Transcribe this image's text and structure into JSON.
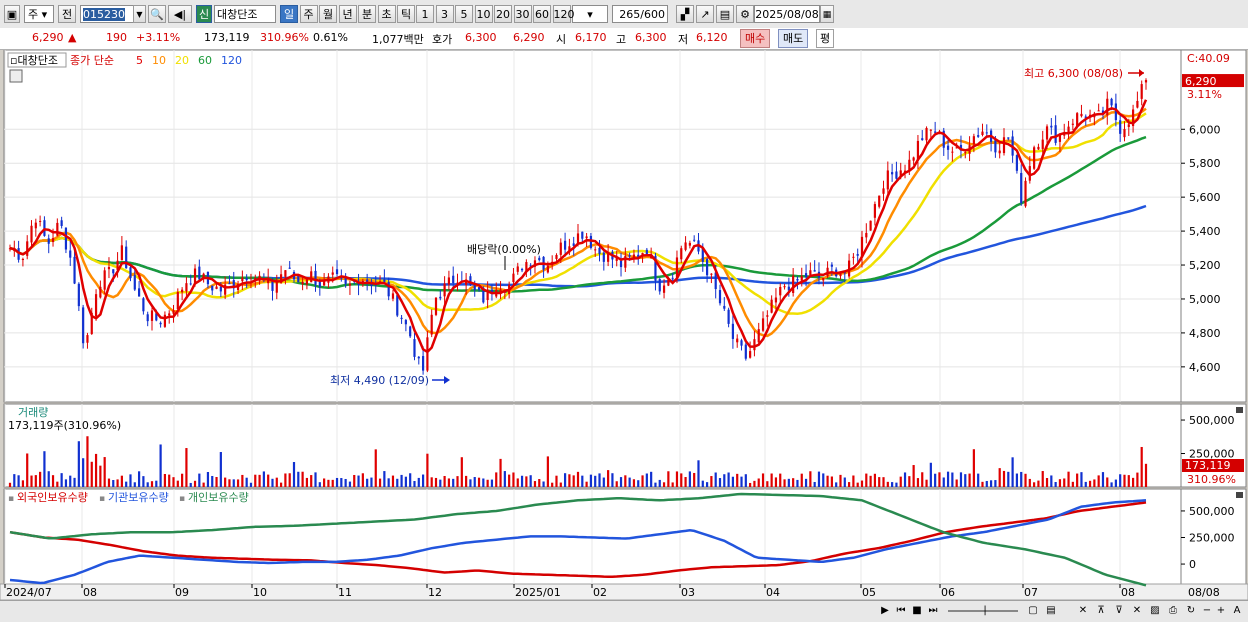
{
  "toolbar": {
    "market_select": "주",
    "prev_label": "전",
    "code": "015230",
    "new_label": "신",
    "stock_name": "대창단조",
    "period_tabs": [
      "일",
      "주",
      "월",
      "년",
      "분",
      "초",
      "틱"
    ],
    "num_tabs": [
      "1",
      "3",
      "5",
      "10",
      "20",
      "30",
      "60",
      "120"
    ],
    "count": "265",
    "count_total": "/600",
    "date": "2025/08/08"
  },
  "quote": {
    "price": "6,290",
    "arrow": "▲",
    "change": "190",
    "change_pct": "+3.11%",
    "volume": "173,119",
    "volume_ratio": "310.96%",
    "turnover_pct": "0.61%",
    "amount": "1,077백만",
    "hoga_label": "호가",
    "hoga_value": "6,300",
    "hoga_value2": "6,290",
    "open_label": "시",
    "open": "6,170",
    "high_label": "고",
    "high": "6,300",
    "low_label": "저",
    "low": "6,120",
    "buy_label": "매수",
    "sell_label": "매도",
    "eval_label": "평"
  },
  "price_panel": {
    "name_tag": "대창단조",
    "ma_label": "종가 단순",
    "ma_periods": [
      "5",
      "10",
      "20",
      "60",
      "120"
    ],
    "ma_colors": [
      "#e00000",
      "#ff8c00",
      "#f0e000",
      "#1a9a3a",
      "#2255dd"
    ],
    "c_label": "C:40.09",
    "last_price_tag": "6,290",
    "last_pct_tag": "3.11%",
    "y_ticks": [
      "6,000",
      "5,800",
      "5,600",
      "5,400",
      "5,200",
      "5,000",
      "4,800",
      "4,600"
    ],
    "high_annotation": "최고 6,300 (08/08)",
    "low_annotation": "최저 4,490 (12/09)",
    "dividend_annotation": "배당락(0.00%)"
  },
  "volume_panel": {
    "title": "거래량",
    "value_text": "173,119주(310.96%)",
    "y_ticks": [
      "500,000",
      "250,000"
    ],
    "last_tag": "173,119",
    "last_pct": "310.96%"
  },
  "holding_panel": {
    "series_names": [
      "외국인보유수량",
      "기관보유수량",
      "개인보유수량"
    ],
    "series_colors": [
      "#d40000",
      "#2255dd",
      "#2a8a50"
    ],
    "y_ticks": [
      "500,000",
      "250,000",
      "0"
    ]
  },
  "x_axis": {
    "labels": [
      "2024/07",
      "08",
      "09",
      "10",
      "11",
      "12",
      "2025/01",
      "02",
      "03",
      "04",
      "05",
      "06",
      "07",
      "08"
    ],
    "last_date": "08/08"
  },
  "chart_data": {
    "type": "candlestick",
    "title": "대창단조",
    "x_range": [
      "2024/07",
      "2025/08/08"
    ],
    "ylim": [
      4490,
      6300
    ],
    "price_path": [
      5300,
      5250,
      5500,
      5320,
      5450,
      5200,
      4700,
      5100,
      5150,
      5280,
      5050,
      4900,
      4870,
      4950,
      5100,
      5150,
      5080,
      5050,
      5100,
      5150,
      5120,
      5060,
      5180,
      5100,
      5150,
      5080,
      5120,
      5060,
      5130,
      5100,
      5080,
      4950,
      4800,
      4540,
      5000,
      5080,
      5150,
      5050,
      5000,
      5100,
      5080,
      5200,
      5250,
      5200,
      5300,
      5350,
      5400,
      5280,
      5250,
      5200,
      5250,
      5300,
      5080,
      5150,
      5350,
      5300,
      5150,
      4950,
      4750,
      4650,
      4800,
      4950,
      5080,
      5100,
      5150,
      5120,
      5180,
      5150,
      5300,
      5500,
      5700,
      5750,
      5800,
      5950,
      6000,
      5900,
      5850,
      5950,
      6000,
      5900,
      5950,
      5600,
      5900,
      6000,
      5950,
      6050,
      6100,
      6050,
      6150,
      6000,
      6100,
      6290
    ],
    "series": [
      {
        "name": "외국인보유수량",
        "values": [
          300000,
          250000,
          230000,
          180000,
          120000,
          80000,
          60000,
          50000,
          40000,
          35000,
          10000,
          -10000,
          -40000,
          -80000,
          -60000,
          -90000,
          -100000,
          -110000,
          -120000,
          -100000,
          -60000,
          -30000,
          -20000,
          -10000,
          30000,
          100000,
          150000,
          220000,
          300000,
          350000,
          390000,
          430000,
          500000,
          540000,
          580000
        ]
      },
      {
        "name": "기관보유수량",
        "values": [
          -150000,
          -180000,
          -100000,
          20000,
          80000,
          60000,
          40000,
          20000,
          10000,
          20000,
          20000,
          40000,
          80000,
          150000,
          200000,
          230000,
          260000,
          260000,
          250000,
          240000,
          280000,
          320000,
          220000,
          60000,
          40000,
          20000,
          60000,
          140000,
          200000,
          260000,
          300000,
          360000,
          420000,
          540000,
          580000,
          600000
        ]
      },
      {
        "name": "개인보유수량",
        "values": [
          300000,
          240000,
          280000,
          300000,
          300000,
          320000,
          350000,
          360000,
          380000,
          400000,
          420000,
          470000,
          500000,
          560000,
          600000,
          620000,
          600000,
          620000,
          660000,
          650000,
          640000,
          600000,
          450000,
          300000,
          200000,
          140000,
          60000,
          -100000,
          -200000
        ]
      }
    ],
    "volume_ylim": [
      0,
      500000
    ]
  }
}
